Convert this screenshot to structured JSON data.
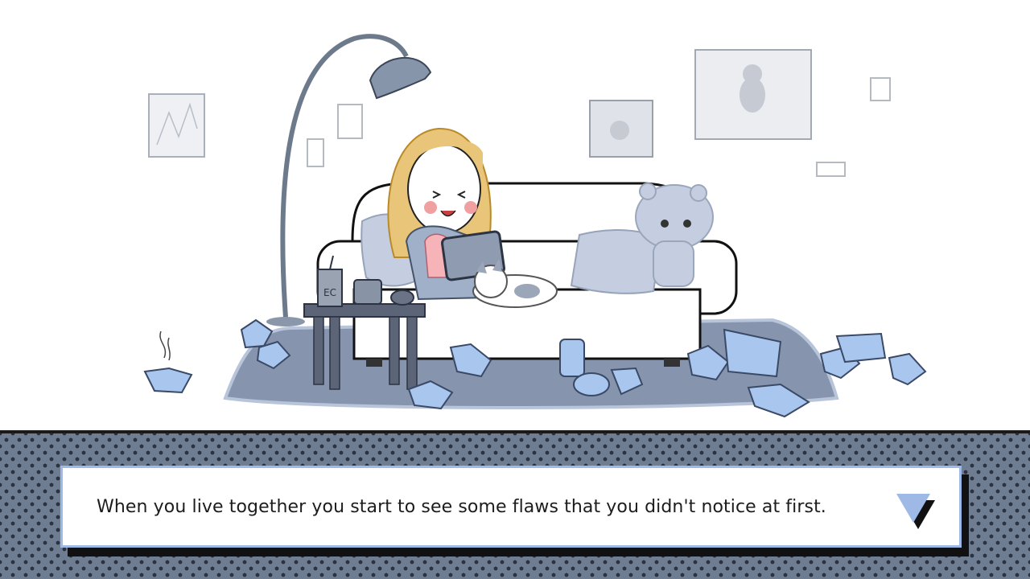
{
  "dialogue": {
    "text": "When you live together you start to see some flaws that you didn't notice at first.",
    "advance_icon": "triangle-down-icon"
  },
  "scene": {
    "cup_label": "EC"
  },
  "colors": {
    "accent_blue": "#9fb9e6",
    "trash_blue": "#a9c6ef",
    "band": "#6f7d93",
    "hair": "#e9c57a"
  }
}
